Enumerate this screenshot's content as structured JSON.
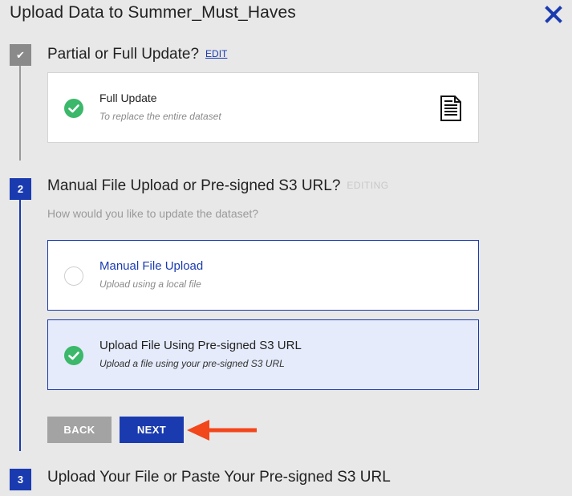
{
  "dialog": {
    "title": "Upload Data to Summer_Must_Haves",
    "close_icon": "close-icon",
    "accent_color": "#1a3bb0"
  },
  "steps": [
    {
      "badge": "✔",
      "title": "Partial or Full Update?",
      "action": "EDIT",
      "selected_option": {
        "title": "Full Update",
        "subtitle": "To replace the entire dataset",
        "icon": "document-icon"
      }
    },
    {
      "badge": "2",
      "title": "Manual File Upload or Pre-signed S3 URL?",
      "status": "EDITING",
      "question": "How would you like to update the dataset?",
      "options": [
        {
          "title": "Manual File Upload",
          "subtitle": "Upload using a local file",
          "selected": false
        },
        {
          "title": "Upload File Using Pre-signed S3 URL",
          "subtitle": "Upload a file using your pre-signed S3 URL",
          "selected": true
        }
      ],
      "buttons": {
        "back": "BACK",
        "next": "NEXT"
      }
    },
    {
      "badge": "3",
      "title": "Upload Your File or Paste Your Pre-signed S3 URL"
    }
  ]
}
